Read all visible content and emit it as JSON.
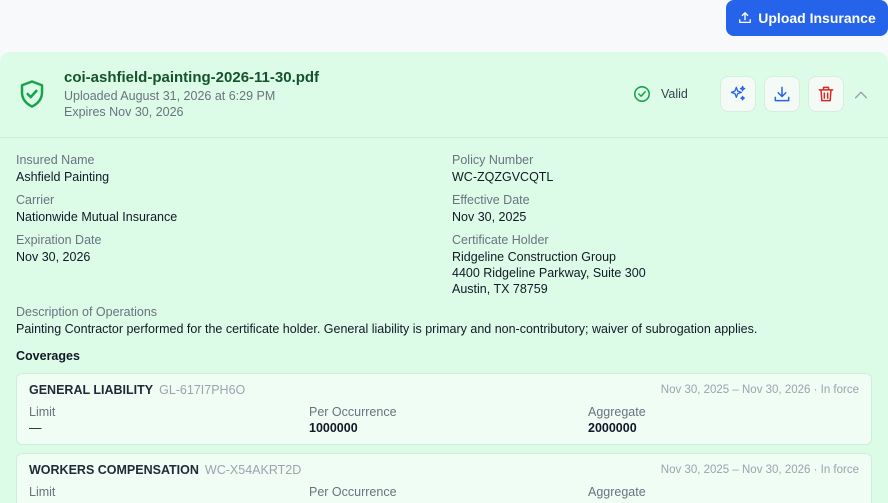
{
  "header": {
    "upload_label": "Upload Insurance"
  },
  "certificate": {
    "file_name": "coi-ashfield-painting-2026-11-30.pdf",
    "uploaded": "Uploaded August 31, 2026 at 6:29 PM",
    "expires": "Expires Nov 30, 2026",
    "status": "Valid",
    "status_color": "#16a34a"
  },
  "details": {
    "insured_name_label": "Insured Name",
    "insured_name": "Ashfield Painting",
    "policy_number_label": "Policy Number",
    "policy_number": "WC-ZQZGVCQTL",
    "carrier_label": "Carrier",
    "carrier": "Nationwide Mutual Insurance",
    "effective_date_label": "Effective Date",
    "effective_date": "Nov 30, 2025",
    "expiration_date_label": "Expiration Date",
    "expiration_date": "Nov 30, 2026",
    "holder_label": "Certificate Holder",
    "holder_line1": "Ridgeline Construction Group",
    "holder_line2": "4400 Ridgeline Parkway, Suite 300",
    "holder_line3": "Austin, TX 78759",
    "description_label": "Description of Operations",
    "description": "Painting Contractor performed for the certificate holder. General liability is primary and non-contributory; waiver of subrogation applies."
  },
  "coverages_title": "Coverages",
  "coverages": [
    {
      "type": "GENERAL LIABILITY",
      "policy": "GL-617I7PH6O",
      "dates": "Nov 30, 2025 – Nov 30, 2026",
      "status": "· In force",
      "limit_label": "Limit",
      "limit": "—",
      "per_occurrence_label": "Per Occurrence",
      "per_occurrence": "1000000",
      "aggregate_label": "Aggregate",
      "aggregate": "2000000"
    },
    {
      "type": "WORKERS COMPENSATION",
      "policy": "WC-X54AKRT2D",
      "dates": "Nov 30, 2025 – Nov 30, 2026",
      "status": "· In force",
      "limit_label": "Limit",
      "per_occurrence_label": "Per Occurrence",
      "aggregate_label": "Aggregate"
    }
  ],
  "colors": {
    "primary": "#2563eb",
    "card_bg": "#dcfce7",
    "danger": "#dc2626",
    "ai": "#2563eb"
  }
}
